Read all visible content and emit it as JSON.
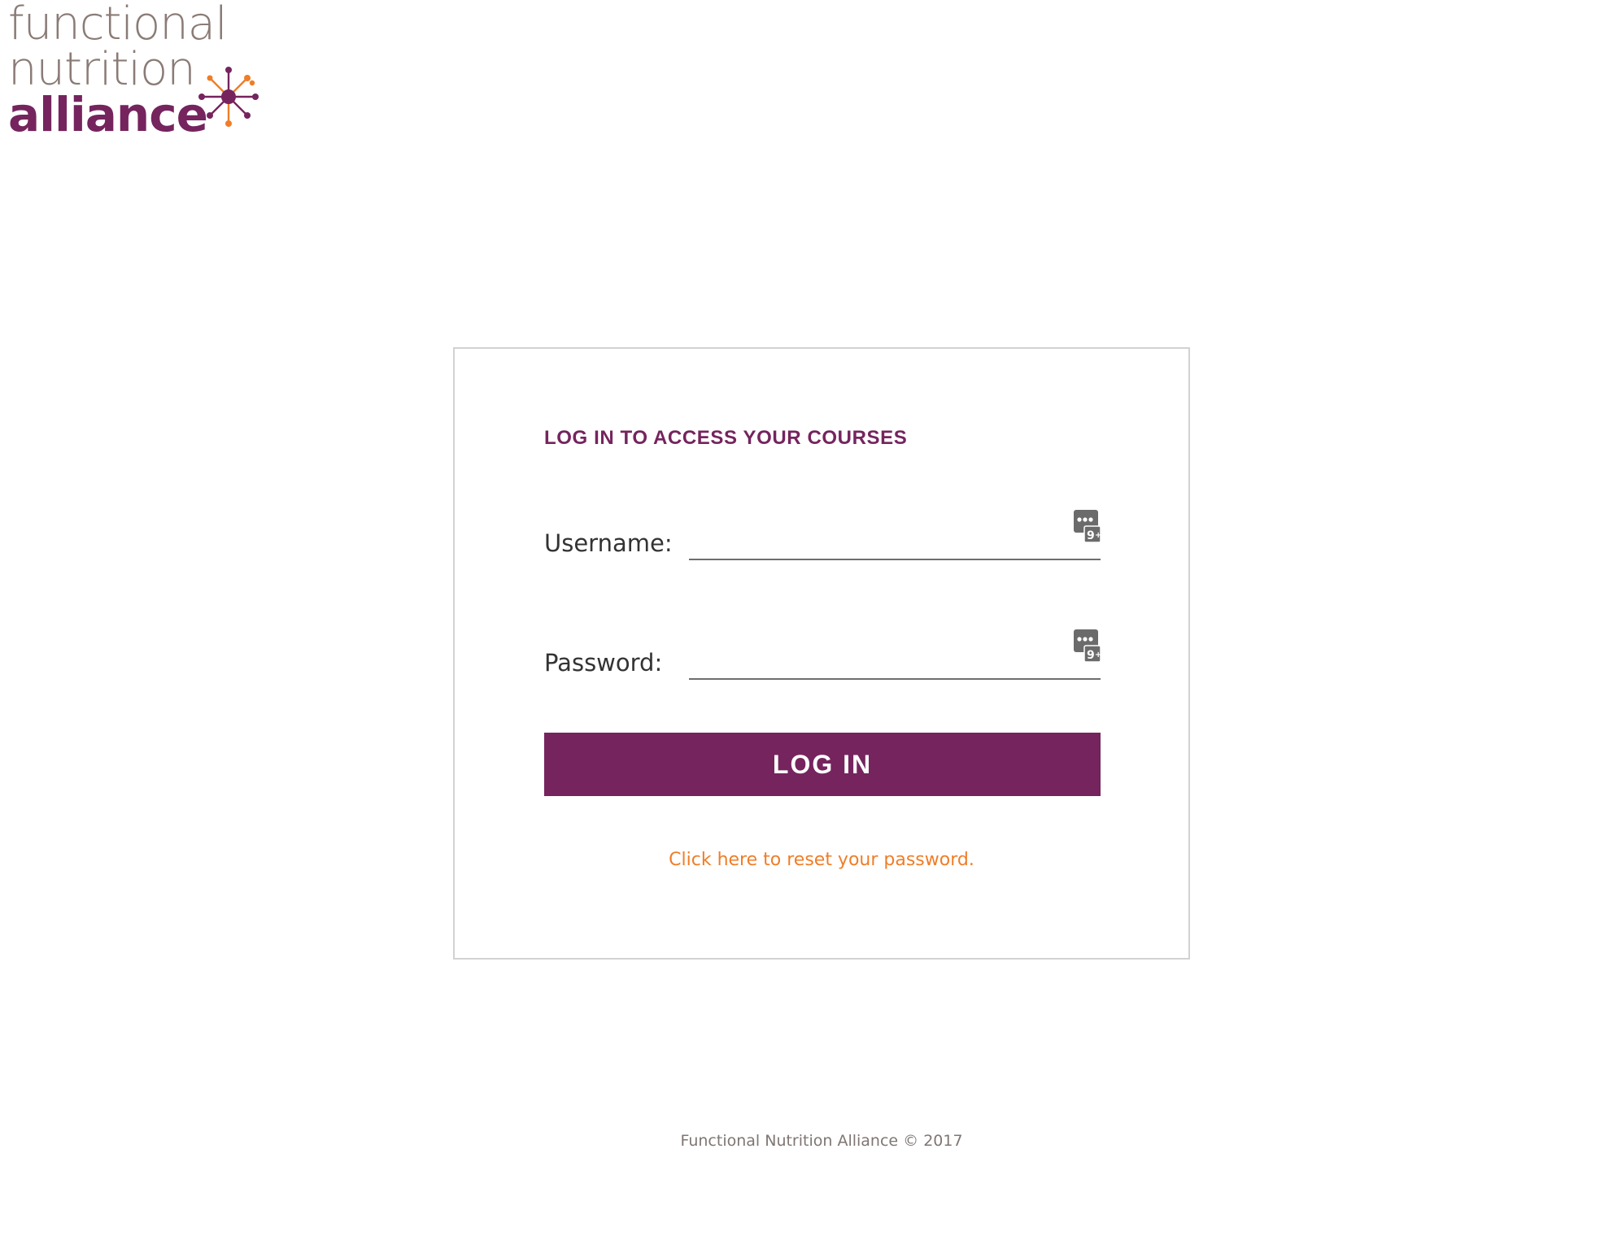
{
  "logo": {
    "line1": "functional",
    "line2": "nutrition",
    "line3": "alliance",
    "icon": "starburst-logo-mark",
    "colors": {
      "brand_purple": "#75245e",
      "brand_gray": "#8a7b76",
      "brand_orange": "#f07d27"
    }
  },
  "login": {
    "title": "LOG IN TO ACCESS YOUR COURSES",
    "username_label": "Username:",
    "username_value": "",
    "password_label": "Password:",
    "password_value": "",
    "password_manager_icon": "password-manager-icon",
    "submit_label": "LOG IN",
    "reset_link": "Click here to reset your password."
  },
  "footer": {
    "text": "Functional Nutrition Alliance © 2017"
  }
}
